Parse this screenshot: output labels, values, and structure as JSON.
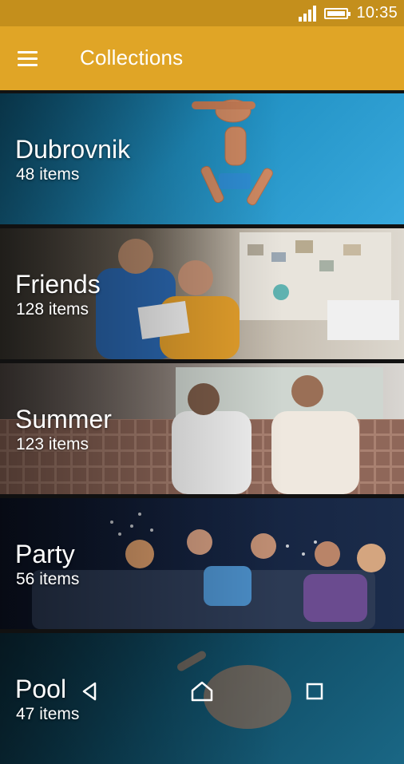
{
  "status_bar": {
    "time": "10:35"
  },
  "app_bar": {
    "title": "Collections",
    "menu_icon": "hamburger-menu-icon"
  },
  "collections": [
    {
      "title": "Dubrovnik",
      "count": "48 items"
    },
    {
      "title": "Friends",
      "count": "128 items"
    },
    {
      "title": "Summer",
      "count": "123 items"
    },
    {
      "title": "Party",
      "count": "56 items"
    },
    {
      "title": "Pool",
      "count": "47 items"
    }
  ],
  "colors": {
    "status_bar": "#c48f1c",
    "app_bar": "#e0a526"
  }
}
